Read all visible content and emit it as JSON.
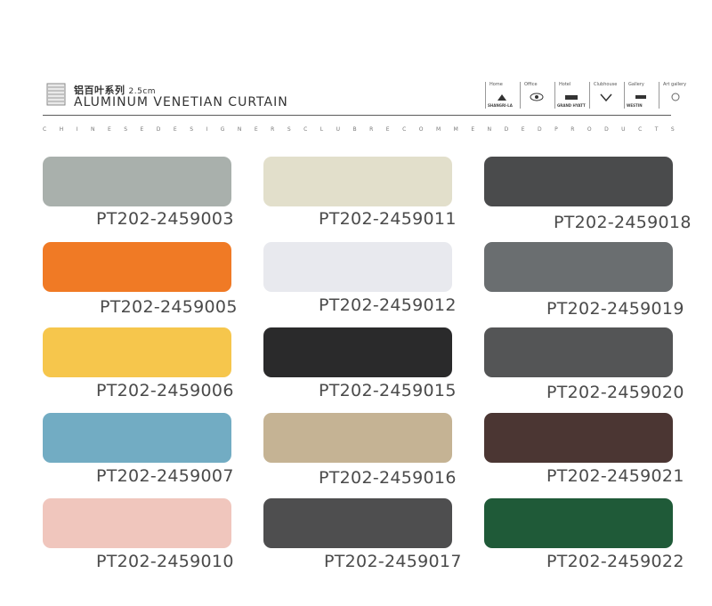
{
  "header": {
    "cn_title": "铝百叶系列",
    "cn_size": "2.5cm",
    "en_title": "ALUMINUM VENETIAN CURTAIN",
    "tagline": "CHINESEDESIGNERSCLUBRECOMMENDEDPRODUCTS"
  },
  "brands": [
    {
      "category": "Home",
      "name": "SHANGRI-LA"
    },
    {
      "category": "Office",
      "name": ""
    },
    {
      "category": "Hotel",
      "name": "GRAND HYATT"
    },
    {
      "category": "Clubhouse",
      "name": ""
    },
    {
      "category": "Gallery",
      "name": "WESTIN"
    },
    {
      "category": "Art gallery",
      "name": ""
    }
  ],
  "swatches": [
    {
      "code": "PT202-2459003",
      "color": "#a9b0ac"
    },
    {
      "code": "PT202-2459011",
      "color": "#e2dfcb"
    },
    {
      "code": "PT202-2459018",
      "color": "#4a4b4c"
    },
    {
      "code": "PT202-2459005",
      "color": "#f07a25"
    },
    {
      "code": "PT202-2459012",
      "color": "#e8e9ee"
    },
    {
      "code": "PT202-2459019",
      "color": "#6a6e70"
    },
    {
      "code": "PT202-2459006",
      "color": "#f6c64c"
    },
    {
      "code": "PT202-2459015",
      "color": "#2a2a2b"
    },
    {
      "code": "PT202-2459020",
      "color": "#545556"
    },
    {
      "code": "PT202-2459007",
      "color": "#72acc3"
    },
    {
      "code": "PT202-2459016",
      "color": "#c5b394"
    },
    {
      "code": "PT202-2459021",
      "color": "#4b3633"
    },
    {
      "code": "PT202-2459010",
      "color": "#f0c6bd"
    },
    {
      "code": "PT202-2459017",
      "color": "#4e4e4f"
    },
    {
      "code": "PT202-2459022",
      "color": "#1f5a38"
    }
  ]
}
